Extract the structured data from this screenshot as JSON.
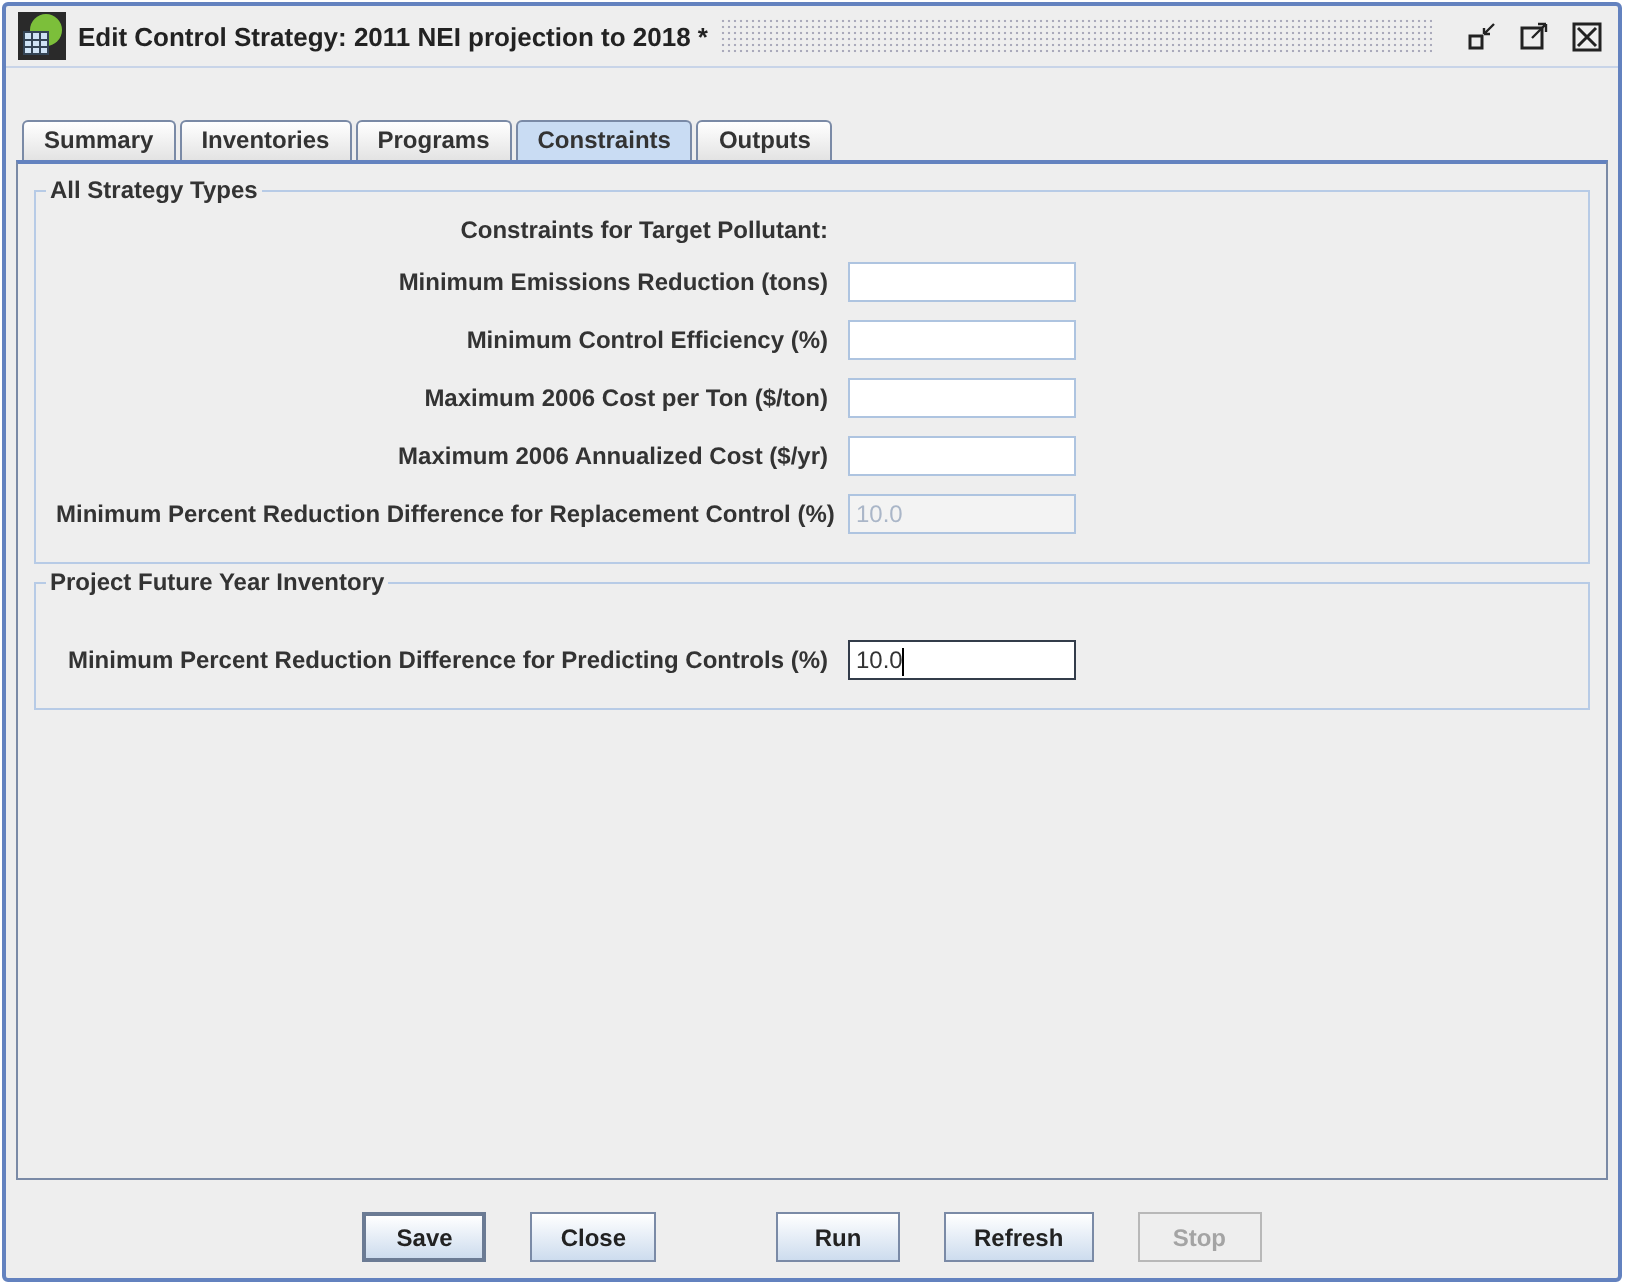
{
  "window": {
    "title": "Edit Control Strategy: 2011 NEI projection to 2018 *"
  },
  "tabs": [
    {
      "label": "Summary",
      "selected": false
    },
    {
      "label": "Inventories",
      "selected": false
    },
    {
      "label": "Programs",
      "selected": false
    },
    {
      "label": "Constraints",
      "selected": true
    },
    {
      "label": "Outputs",
      "selected": false
    }
  ],
  "groups": [
    {
      "title": "All Strategy Types",
      "heading": "Constraints for Target Pollutant:",
      "fields": [
        {
          "label": "Minimum Emissions Reduction (tons)",
          "disabled": false,
          "focused": false
        },
        {
          "label": "Minimum Control Efficiency (%)",
          "disabled": false,
          "focused": false
        },
        {
          "label": "Maximum 2006 Cost per Ton ($/ton)",
          "disabled": false,
          "focused": false
        },
        {
          "label": "Maximum 2006 Annualized Cost ($/yr)",
          "disabled": false,
          "focused": false
        },
        {
          "label": "Minimum Percent Reduction Difference for Replacement Control (%)",
          "value": "10.0",
          "disabled": true,
          "focused": false
        }
      ]
    },
    {
      "title": "Project Future Year Inventory",
      "fields": [
        {
          "label": "Minimum Percent Reduction Difference for Predicting Controls (%)",
          "value": "10.0",
          "disabled": false,
          "focused": true
        }
      ]
    }
  ],
  "buttons": [
    {
      "label": "Save",
      "default": true,
      "disabled": false
    },
    {
      "label": "Close",
      "default": false,
      "disabled": false
    },
    {
      "label": "Run",
      "default": false,
      "disabled": false
    },
    {
      "label": "Refresh",
      "default": false,
      "disabled": false
    },
    {
      "label": "Stop",
      "default": false,
      "disabled": true
    }
  ]
}
